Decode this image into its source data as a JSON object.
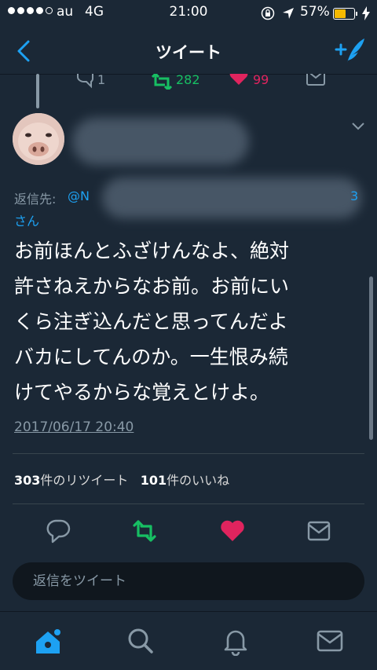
{
  "status_bar": {
    "carrier": "au",
    "network": "4G",
    "time": "21:00",
    "battery": "57%",
    "battery_level": 0.57,
    "signal_bars": 4
  },
  "nav": {
    "title": "ツイート",
    "back_icon": "chevron-left-icon",
    "compose_icon": "compose-tweet-icon"
  },
  "previous_tweet": {
    "reply_count": "1",
    "retweet_count": "282",
    "like_count": "99"
  },
  "tweet": {
    "reply_label": "返信先:",
    "reply_handle": "@N",
    "reply_handle_suffix": "3",
    "reply_san": "さん",
    "text_lines": [
      "お前ほんとふざけんなよ、絶対",
      "許さねえからなお前。お前にい",
      "くら注ぎ込んだと思ってんだよ",
      "バカにしてんのか。一生恨み続",
      "けてやるからな覚えとけよ。"
    ],
    "timestamp": "2017/06/17 20:40",
    "retweet_count": "303",
    "retweet_label": "件のリツイート",
    "like_count": "101",
    "like_label": "件のいいね"
  },
  "reply_input": {
    "placeholder": "返信をツイート"
  },
  "colors": {
    "background": "#1b2836",
    "accent": "#1da1f2",
    "retweet": "#17bf63",
    "like": "#e0245e",
    "muted": "#8899a6"
  },
  "tabs": [
    "home-icon",
    "search-icon",
    "notifications-icon",
    "messages-icon"
  ]
}
